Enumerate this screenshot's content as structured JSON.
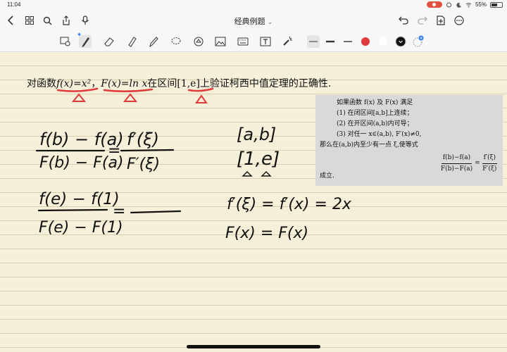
{
  "status": {
    "time": "11:04",
    "battery": "55%",
    "battery_level": 0.55
  },
  "nav": {
    "title": "经典例题",
    "title_chevron": "⌄"
  },
  "colors": {
    "ink": "#111111",
    "red_ink": "#e03a3a",
    "theorem_bg": "#d9d9d9",
    "paper": "#f6f0da"
  },
  "problem": {
    "p1": "对函数",
    "f1": "f(x)=x²",
    "sep": "，",
    "f2": "F(x)=ln x",
    "p2": "在区间",
    "interval": "[1,e]",
    "p3": "上验证柯西中值定理的正确性."
  },
  "theorem": {
    "line1": "如果函数 f(x) 及 F(x) 满足",
    "line2": "(1) 在闭区间[a,b]上连续；",
    "line3": "(2) 在开区间(a,b)内可导；",
    "line4": "(3) 对任一 x∈(a,b), F′(x)≠0,",
    "line5": "那么在(a,b)内至少有一点 ξ,使等式",
    "frac1_num": "f(b)−f(a)",
    "frac1_den": "F(b)−F(a)",
    "eq": "=",
    "frac2_num": "f′(ξ)",
    "frac2_den": "F′(ξ)",
    "end": "成立."
  },
  "handwriting": {
    "f1_num": "f(b) − f(a)",
    "f1_den": "F(b) − F(a)",
    "eq1": "=",
    "f2_num": "f′(ξ)",
    "f2_den": "F′(ξ)",
    "f3_num": "f(e) − f(1)",
    "f3_den": "F(e) − F(1)",
    "eq2": "=",
    "interval_ab": "[a,b]",
    "interval_1e": "[1,e]",
    "deriv_f": "f′(ξ) = f′(x) = 2x",
    "deriv_F": "F(x) = F(x)"
  }
}
